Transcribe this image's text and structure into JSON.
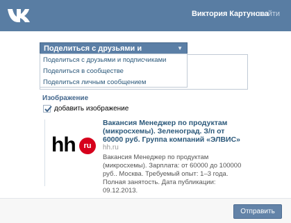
{
  "header": {
    "logo_icon": "vk-logo-icon",
    "user_name": "Виктория Картунова",
    "logout_label": "выйти",
    "background_color": "#597da3"
  },
  "share": {
    "selected": "Поделиться с друзьями и подписчиками",
    "arrow_icon": "chevron-down-icon",
    "options": [
      "Поделиться с друзьями и подписчиками",
      "Поделиться в сообществе",
      "Поделиться личным сообщением"
    ]
  },
  "image_section": {
    "title": "Изображение",
    "checkbox_label": "добавить изображение",
    "checked": true
  },
  "attachment": {
    "logo_text": "hh",
    "logo_badge": "ru",
    "title": "Вакансия Менеджер по продуктам (микросхемы). Зеленоград. З/п от 60000 руб. Группа компаний «ЭЛВИС»",
    "domain": "hh.ru",
    "description": "Вакансия Менеджер по продуктам (микросхемы). Зарплата: от 60000 до 100000 руб.. Москва. Требуемый опыт: 1–3 года. Полная занятость. Дата публикации: 09.12.2013."
  },
  "footer": {
    "send_label": "Отправить"
  }
}
